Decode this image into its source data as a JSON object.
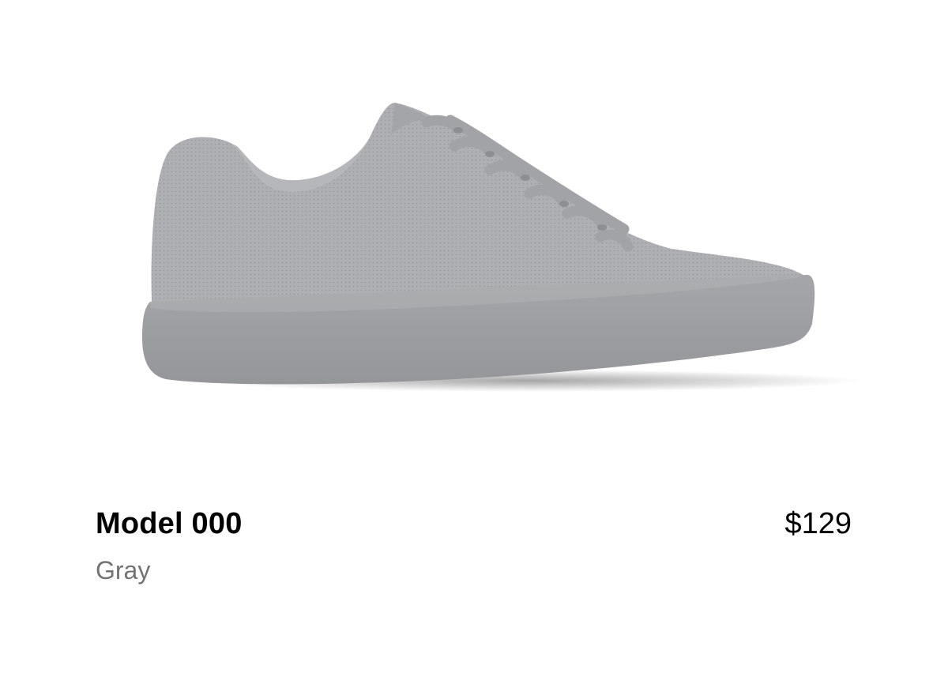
{
  "product": {
    "name": "Model 000",
    "color": "Gray",
    "price": "$129",
    "image_icon": "sneaker-image",
    "colors": {
      "upper": "#a9abae",
      "sole": "#9c9ea1",
      "text_primary": "#000000",
      "text_secondary": "#737373"
    }
  }
}
